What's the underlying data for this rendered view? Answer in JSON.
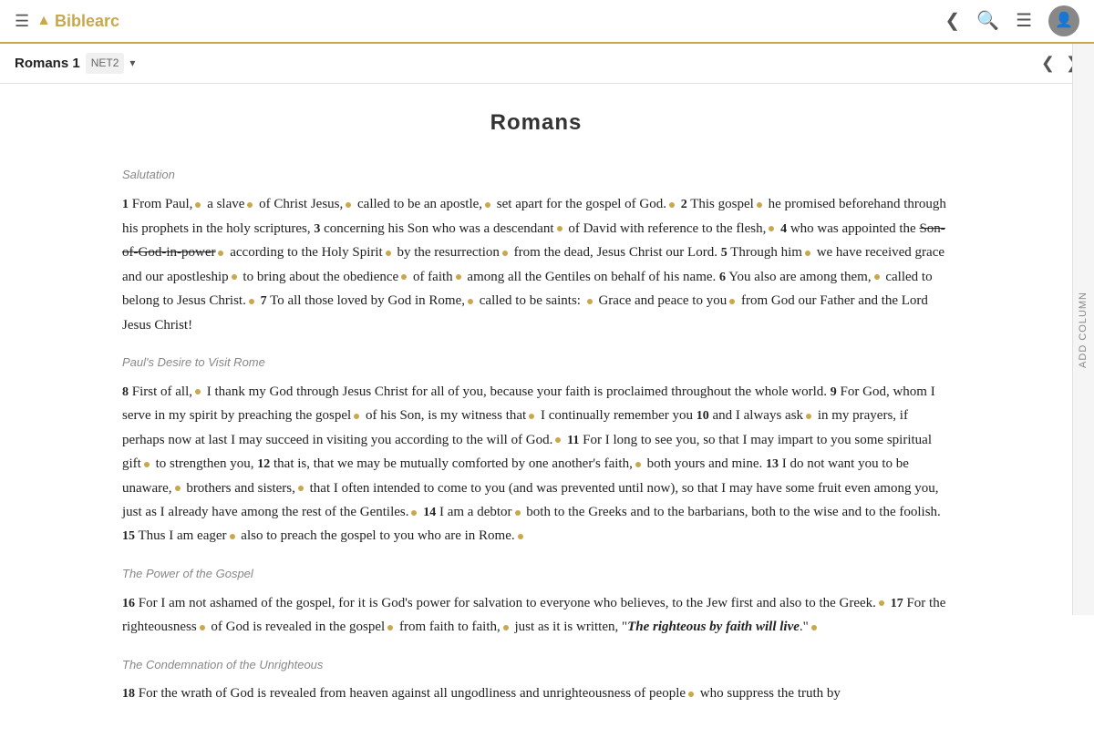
{
  "app": {
    "name": "Biblearc",
    "logo_arrow": "▲"
  },
  "nav": {
    "book": "Romans 1",
    "version": "NET2",
    "add_column_label": "ADD COLUMN"
  },
  "page": {
    "title": "Romans",
    "sections": [
      {
        "id": "salutation",
        "heading": "Salutation",
        "content": "salutation-block"
      },
      {
        "id": "desire",
        "heading": "Paul's Desire to Visit Rome",
        "content": "desire-block"
      },
      {
        "id": "power",
        "heading": "The Power of the Gospel",
        "content": "power-block"
      },
      {
        "id": "condemnation",
        "heading": "The Condemnation of the Unrighteous",
        "content": "condemnation-block"
      }
    ]
  }
}
